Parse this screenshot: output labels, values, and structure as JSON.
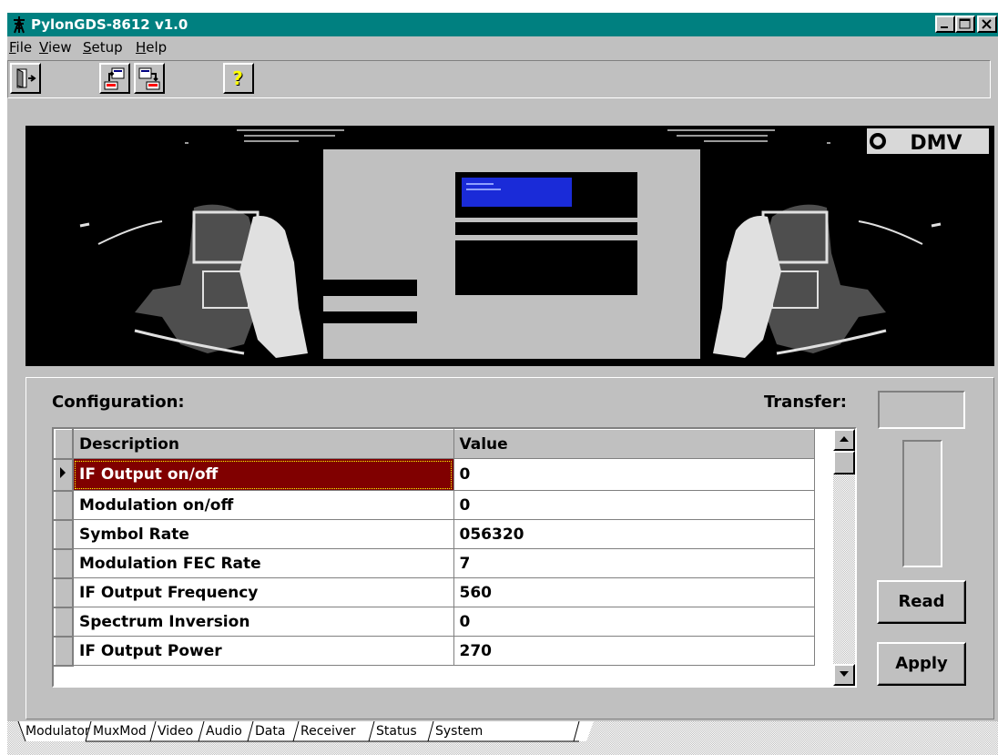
{
  "window": {
    "title": "PylonGDS-8612 v1.0",
    "title_color": "#008080",
    "caption_buttons": [
      "minimize-icon",
      "maximize-icon",
      "close-icon"
    ]
  },
  "menu": [
    {
      "prefix": "",
      "underline": "F",
      "rest": "ile"
    },
    {
      "prefix": "",
      "underline": "V",
      "rest": "iew"
    },
    {
      "prefix": "",
      "underline": "S",
      "rest": "etup"
    },
    {
      "prefix": "",
      "underline": "H",
      "rest": "elp"
    }
  ],
  "toolbar": {
    "buttons": [
      "exit-door-icon",
      "upload-to-device-icon",
      "download-from-device-icon",
      "help-question-icon"
    ]
  },
  "banner": {
    "logo_text": "DMV",
    "lcd_color": "#1a2bd8"
  },
  "config": {
    "label": "Configuration:",
    "transfer_label": "Transfer:",
    "columns": [
      "Description",
      "Value"
    ],
    "rows": [
      {
        "description": "IF Output on/off",
        "value": "0"
      },
      {
        "description": "Modulation on/off",
        "value": "0"
      },
      {
        "description": "Symbol Rate",
        "value": "056320"
      },
      {
        "description": "Modulation FEC Rate",
        "value": "7"
      },
      {
        "description": "IF Output Frequency",
        "value": "560"
      },
      {
        "description": "Spectrum Inversion",
        "value": "0"
      },
      {
        "description": "IF Output Power",
        "value": "270"
      }
    ],
    "selected_row": 0,
    "selected_color": "#800000"
  },
  "buttons": {
    "read": "Read",
    "apply": "Apply"
  },
  "tabs": [
    "Modulator",
    "MuxMod",
    "Video",
    "Audio",
    "Data",
    "Receiver",
    "Status",
    "System"
  ],
  "active_tab": "Modulator"
}
